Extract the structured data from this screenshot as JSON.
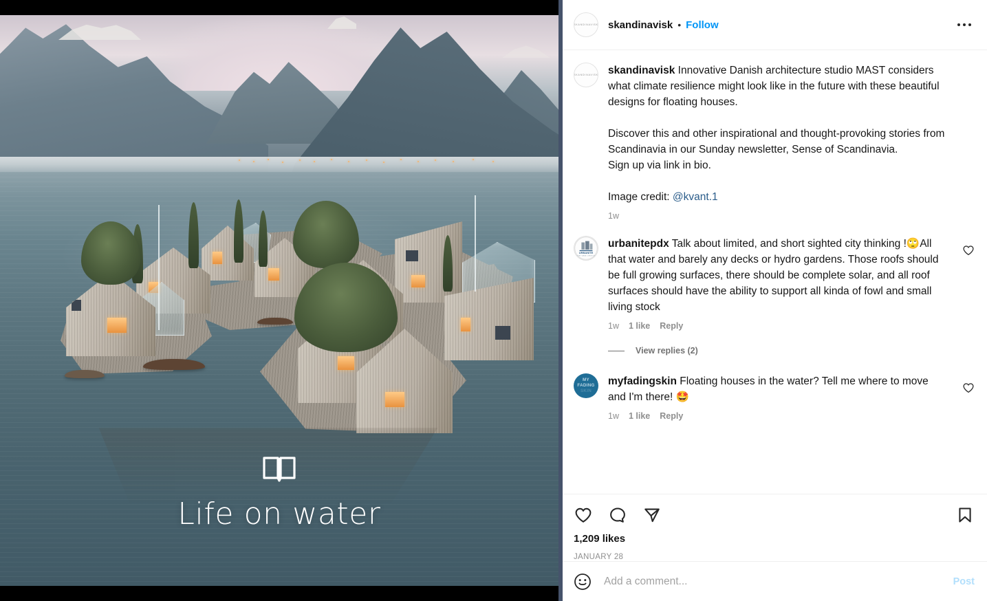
{
  "media": {
    "overlay_title": "Life on water",
    "book_icon": "open-book-icon",
    "scene": "Aerial rendering of floating wooden houses on a lake surrounded by alpine mountains at dusk"
  },
  "header": {
    "username": "skandinavisk",
    "separator": "•",
    "follow_label": "Follow",
    "avatar_text": "SKANDINAVISK",
    "more_icon": "more-options-icon"
  },
  "caption": {
    "username": "skandinavisk",
    "paragraph1": " Innovative Danish architecture studio MAST considers what climate resilience might look like in the future with these beautiful designs for floating houses.",
    "paragraph2": "Discover this and other inspirational and thought-provoking stories from Scandinavia in our Sunday newsletter, Sense of Scandinavia.",
    "paragraph3": "Sign up via link in bio.",
    "credit_label": "Image credit: ",
    "credit_mention": "@kvant.1",
    "timestamp": "1w"
  },
  "comments": [
    {
      "username": "urbanitepdx",
      "avatar_text": "URBANITE",
      "text": " Talk about limited, and short sighted city thinking !🙄All that water and barely any decks or hydro gardens. Those roofs should be full growing surfaces, there should be complete solar, and all roof surfaces should have the ability to support all kinda of fowl and small living stock",
      "timestamp": "1w",
      "likes": "1 like",
      "reply_label": "Reply",
      "like_icon": "heart-outline-icon",
      "view_replies": "View replies (2)"
    },
    {
      "username": "myfadingskin",
      "avatar_line1": "MY",
      "avatar_line2": "FADING",
      "avatar_line3": "SKIN",
      "text": " Floating houses in the water? Tell me where to move and I'm there! 🤩",
      "timestamp": "1w",
      "likes": "1 like",
      "reply_label": "Reply",
      "like_icon": "heart-outline-icon"
    }
  ],
  "actions": {
    "like_icon": "heart-outline-icon",
    "comment_icon": "comment-bubble-icon",
    "share_icon": "share-paper-plane-icon",
    "save_icon": "bookmark-outline-icon",
    "likes_count": "1,209 likes",
    "post_date": "JANUARY 28"
  },
  "add_comment": {
    "emoji_icon": "smiley-face-icon",
    "placeholder": "Add a comment...",
    "value": "",
    "post_label": "Post"
  },
  "colors": {
    "accent_blue": "#0095f6",
    "link_blue": "#2a5c8a",
    "post_disabled": "#b2dffc",
    "text_primary": "#171717",
    "text_muted": "#8e8e8e",
    "avatar_blue": "#1f6d96"
  }
}
